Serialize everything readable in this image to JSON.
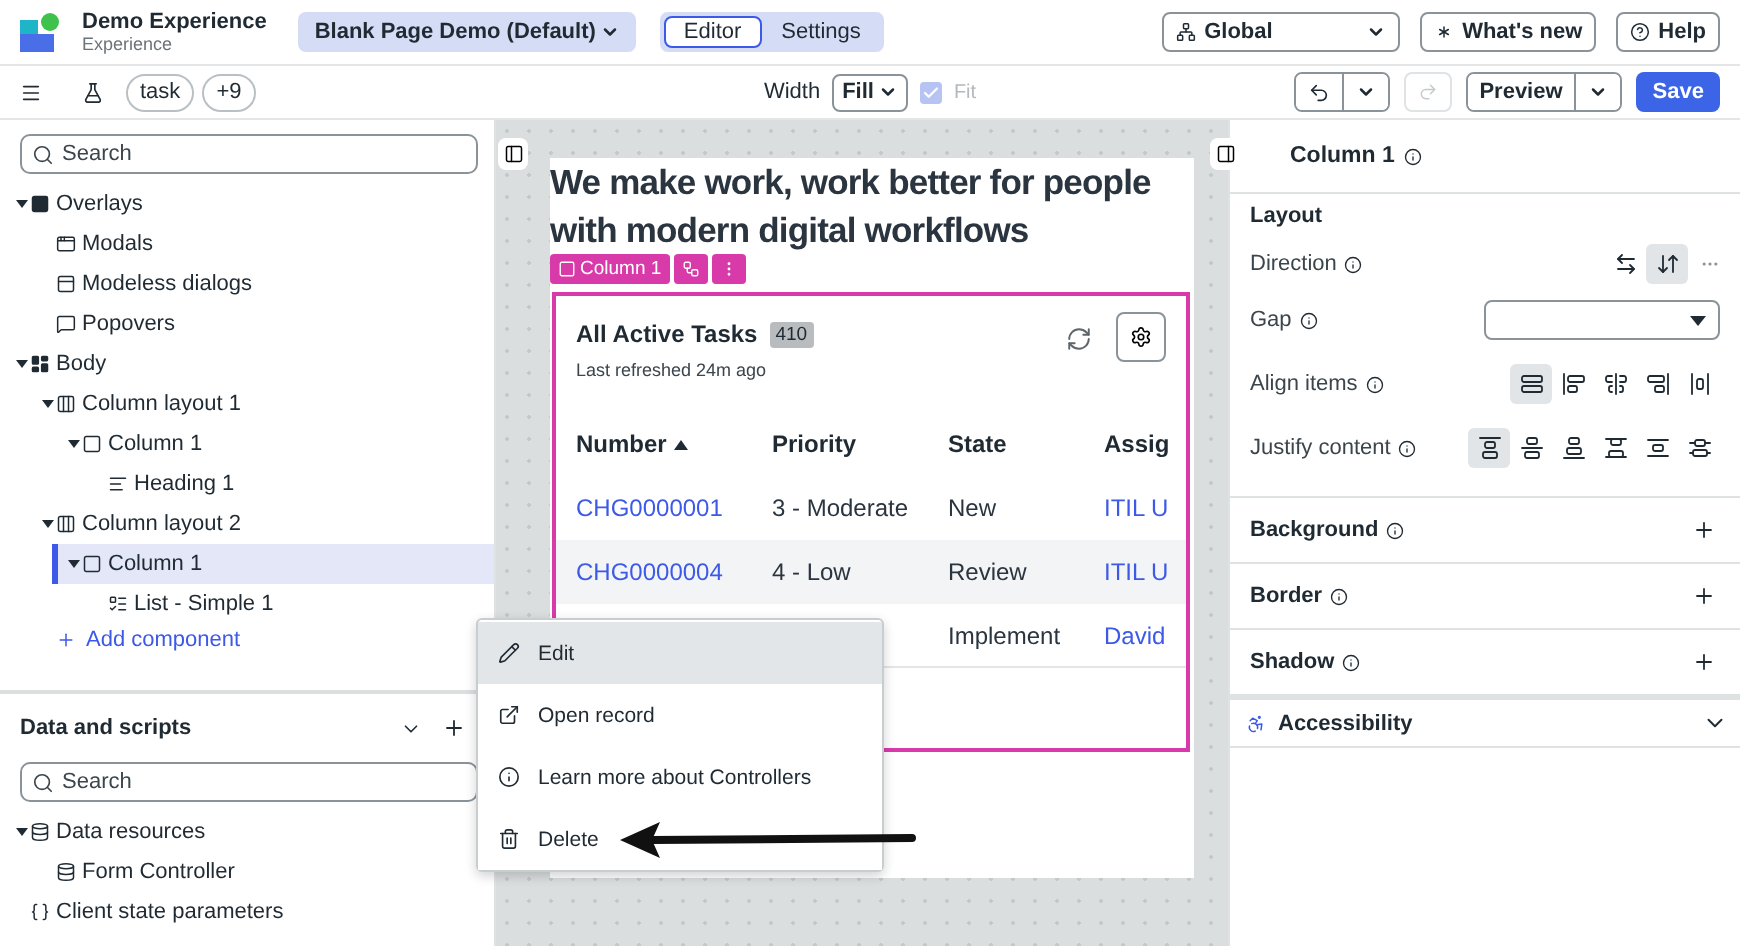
{
  "app": {
    "title": "Demo Experience",
    "subtitle": "Experience",
    "page_select": "Blank Page Demo (Default)",
    "modes": [
      {
        "label": "Editor",
        "selected": true
      },
      {
        "label": "Settings",
        "selected": false
      }
    ],
    "scope_select": "Global",
    "whats_new": "What's new",
    "help": "Help"
  },
  "toolbar": {
    "chips": [
      "task",
      "+9"
    ],
    "width_label": "Width",
    "width_select": "Fill",
    "fit": {
      "label": "Fit",
      "checked": true,
      "disabled": true
    },
    "redo_disabled": true,
    "preview": "Preview",
    "save": "Save"
  },
  "outline": {
    "search_placeholder": "Search",
    "add_component": "Add component",
    "tree": [
      {
        "label": "Overlays",
        "kind": "overlay",
        "expanded": true,
        "selected": false,
        "children": [
          {
            "label": "Modals",
            "kind": "modal",
            "selected": false
          },
          {
            "label": "Modeless dialogs",
            "kind": "dialog",
            "selected": false
          },
          {
            "label": "Popovers",
            "kind": "popover",
            "selected": false
          }
        ]
      },
      {
        "label": "Body",
        "kind": "body",
        "expanded": true,
        "selected": false,
        "children": [
          {
            "label": "Column layout 1",
            "kind": "layout",
            "expanded": true,
            "selected": false,
            "children": [
              {
                "label": "Column 1",
                "kind": "column",
                "expanded": true,
                "selected": false,
                "children": [
                  {
                    "label": "Heading 1",
                    "kind": "heading",
                    "selected": false
                  }
                ]
              }
            ]
          },
          {
            "label": "Column layout 2",
            "kind": "layout",
            "expanded": true,
            "selected": false,
            "children": [
              {
                "label": "Column 1",
                "kind": "column",
                "expanded": true,
                "selected": true,
                "children": [
                  {
                    "label": "List - Simple 1",
                    "kind": "list",
                    "selected": false
                  }
                ]
              }
            ]
          }
        ]
      }
    ]
  },
  "data_scripts": {
    "title": "Data and scripts",
    "search_placeholder": "Search",
    "tree": [
      {
        "label": "Data resources",
        "kind": "data",
        "expanded": true,
        "selected": false,
        "children": [
          {
            "label": "Form Controller",
            "kind": "data",
            "selected": false
          }
        ]
      },
      {
        "label": "Client state parameters",
        "kind": "params",
        "selected": false
      }
    ]
  },
  "canvas": {
    "heading": "We make work, work better for people with modern digital workflows",
    "column_tag": "Column 1",
    "list": {
      "title": "All Active Tasks",
      "count": "410",
      "refreshed": "Last refreshed 24m ago",
      "columns": [
        {
          "label": "Number",
          "sorted": true,
          "kind": "link"
        },
        {
          "label": "Priority",
          "sorted": false,
          "kind": "text"
        },
        {
          "label": "State",
          "sorted": false,
          "kind": "text"
        },
        {
          "label": "Assig",
          "sorted": false,
          "kind": "link"
        }
      ],
      "rows": [
        {
          "cells": [
            "CHG0000001",
            "3 - Moderate",
            "New",
            "ITIL U"
          ],
          "highlighted": false
        },
        {
          "cells": [
            "CHG0000004",
            "4 - Low",
            "Review",
            "ITIL U"
          ],
          "highlighted": true
        },
        {
          "cells": [
            null,
            null,
            "Implement",
            "David"
          ],
          "highlighted": false
        }
      ]
    }
  },
  "context_menu": [
    {
      "label": "Edit",
      "kind": "edit",
      "highlighted": true
    },
    {
      "label": "Open record",
      "kind": "open",
      "highlighted": false
    },
    {
      "label": "Learn more about Controllers",
      "kind": "info",
      "highlighted": false
    },
    {
      "label": "Delete",
      "kind": "delete",
      "highlighted": false
    }
  ],
  "inspector": {
    "title": "Column 1",
    "layout": {
      "title": "Layout",
      "direction": {
        "label": "Direction",
        "options": [
          {
            "selected": false
          },
          {
            "selected": true
          }
        ]
      },
      "gap": {
        "label": "Gap"
      },
      "align": {
        "label": "Align items",
        "options": [
          {
            "selected": true
          },
          {
            "selected": false
          },
          {
            "selected": false
          },
          {
            "selected": false
          },
          {
            "selected": false
          }
        ]
      },
      "justify": {
        "label": "Justify content",
        "options": [
          {
            "selected": true
          },
          {
            "selected": false
          },
          {
            "selected": false
          },
          {
            "selected": false
          },
          {
            "selected": false
          },
          {
            "selected": false
          }
        ]
      }
    },
    "sections": [
      {
        "label": "Background"
      },
      {
        "label": "Border"
      },
      {
        "label": "Shadow"
      }
    ],
    "accessibility": {
      "label": "Accessibility",
      "expanded": false
    }
  }
}
